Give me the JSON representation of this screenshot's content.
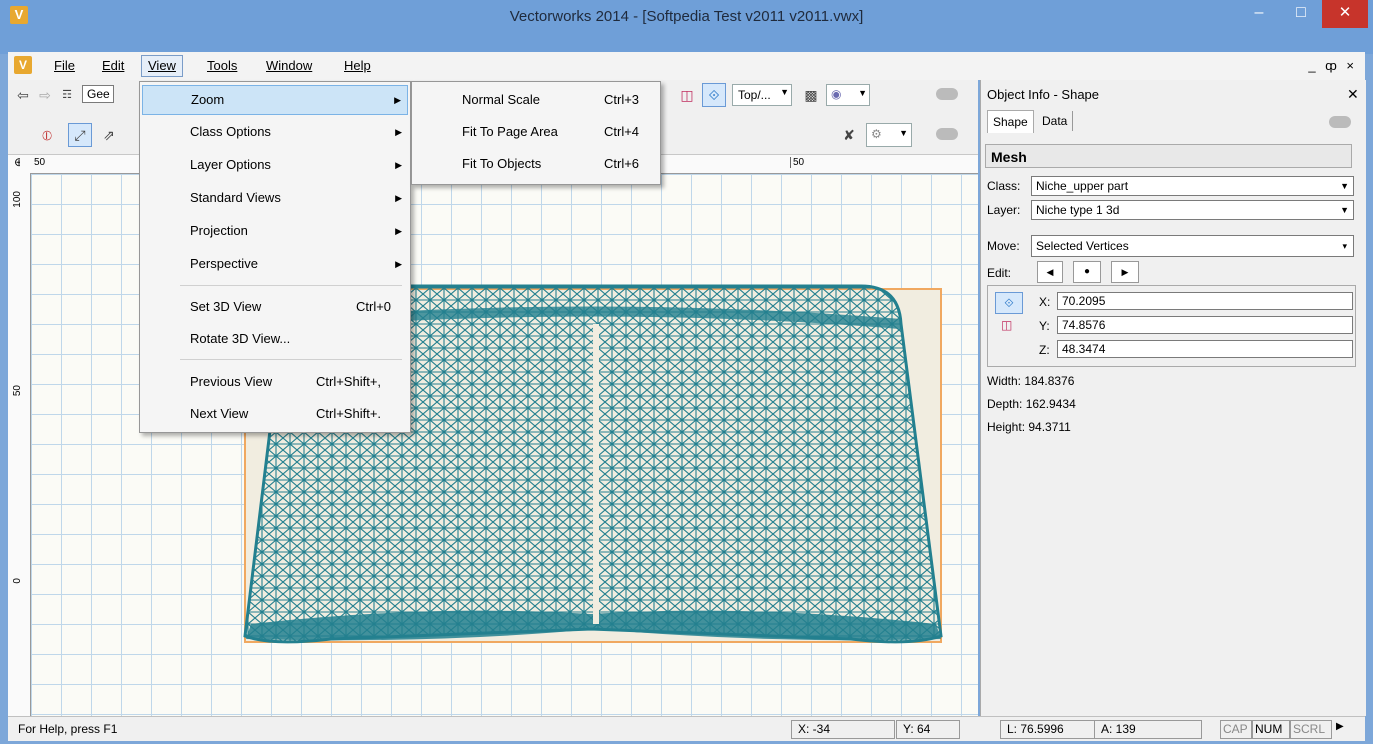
{
  "window": {
    "title": "Vectorworks 2014 - [Softpedia Test v2011 v2011.vwx]",
    "app_icon": "V"
  },
  "menubar": {
    "items": [
      {
        "label": "File",
        "ul": "F"
      },
      {
        "label": "Edit",
        "ul": "E"
      },
      {
        "label": "View",
        "ul": "V"
      },
      {
        "label": "Tools",
        "ul": "T"
      },
      {
        "label": "Window",
        "ul": "W"
      },
      {
        "label": "Help",
        "ul": "H"
      }
    ],
    "doc_controls": "_ ȹ ×"
  },
  "view_menu": [
    {
      "label": "Zoom",
      "submenu": true
    },
    {
      "label": "Class Options",
      "submenu": true
    },
    {
      "label": "Layer Options",
      "submenu": true
    },
    {
      "label": "Standard Views",
      "submenu": true
    },
    {
      "label": "Projection",
      "submenu": true
    },
    {
      "label": "Perspective",
      "submenu": true
    },
    {
      "label": "Set 3D View",
      "shortcut": "Ctrl+0"
    },
    {
      "label": "Rotate 3D View..."
    },
    {
      "label": "Previous View",
      "shortcut": "Ctrl+Shift+,"
    },
    {
      "label": "Next View",
      "shortcut": "Ctrl+Shift+."
    }
  ],
  "zoom_menu": [
    {
      "label": "Normal Scale",
      "shortcut": "Ctrl+3"
    },
    {
      "label": "Fit To Page Area",
      "shortcut": "Ctrl+4"
    },
    {
      "label": "Fit To Objects",
      "shortcut": "Ctrl+6"
    }
  ],
  "toolbar": {
    "class_field": "Gee",
    "view_select": "Top/..."
  },
  "rulers": {
    "top_left": "50",
    "top_mid": "50",
    "left_labels": [
      "100",
      "50",
      "0"
    ]
  },
  "panel": {
    "title": "Object Info - Shape",
    "tabs": [
      "Shape",
      "Data"
    ],
    "object_type": "Mesh",
    "class_label": "Class:",
    "class_value": "Niche_upper part",
    "layer_label": "Layer:",
    "layer_value": "Niche type 1 3d",
    "move_label": "Move:",
    "move_value": "Selected Vertices",
    "edit_label": "Edit:",
    "x_label": "X:",
    "x_value": "70.2095",
    "y_label": "Y:",
    "y_value": "74.8576",
    "z_label": "Z:",
    "z_value": "48.3474",
    "width": "Width: 184.8376",
    "depth": "Depth: 162.9434",
    "height": "Height: 94.3711"
  },
  "statusbar": {
    "help": "For Help, press F1",
    "x": "X: -34",
    "y": "Y: 64",
    "l": "L: 76.5996",
    "a": "A: 139",
    "cap": "CAP",
    "num": "NUM",
    "scrl": "SCRL"
  },
  "colors": {
    "mesh": "#23808f",
    "selection": "#f0a860",
    "titlebar": "#6f9fd8",
    "close": "#c7342b"
  }
}
